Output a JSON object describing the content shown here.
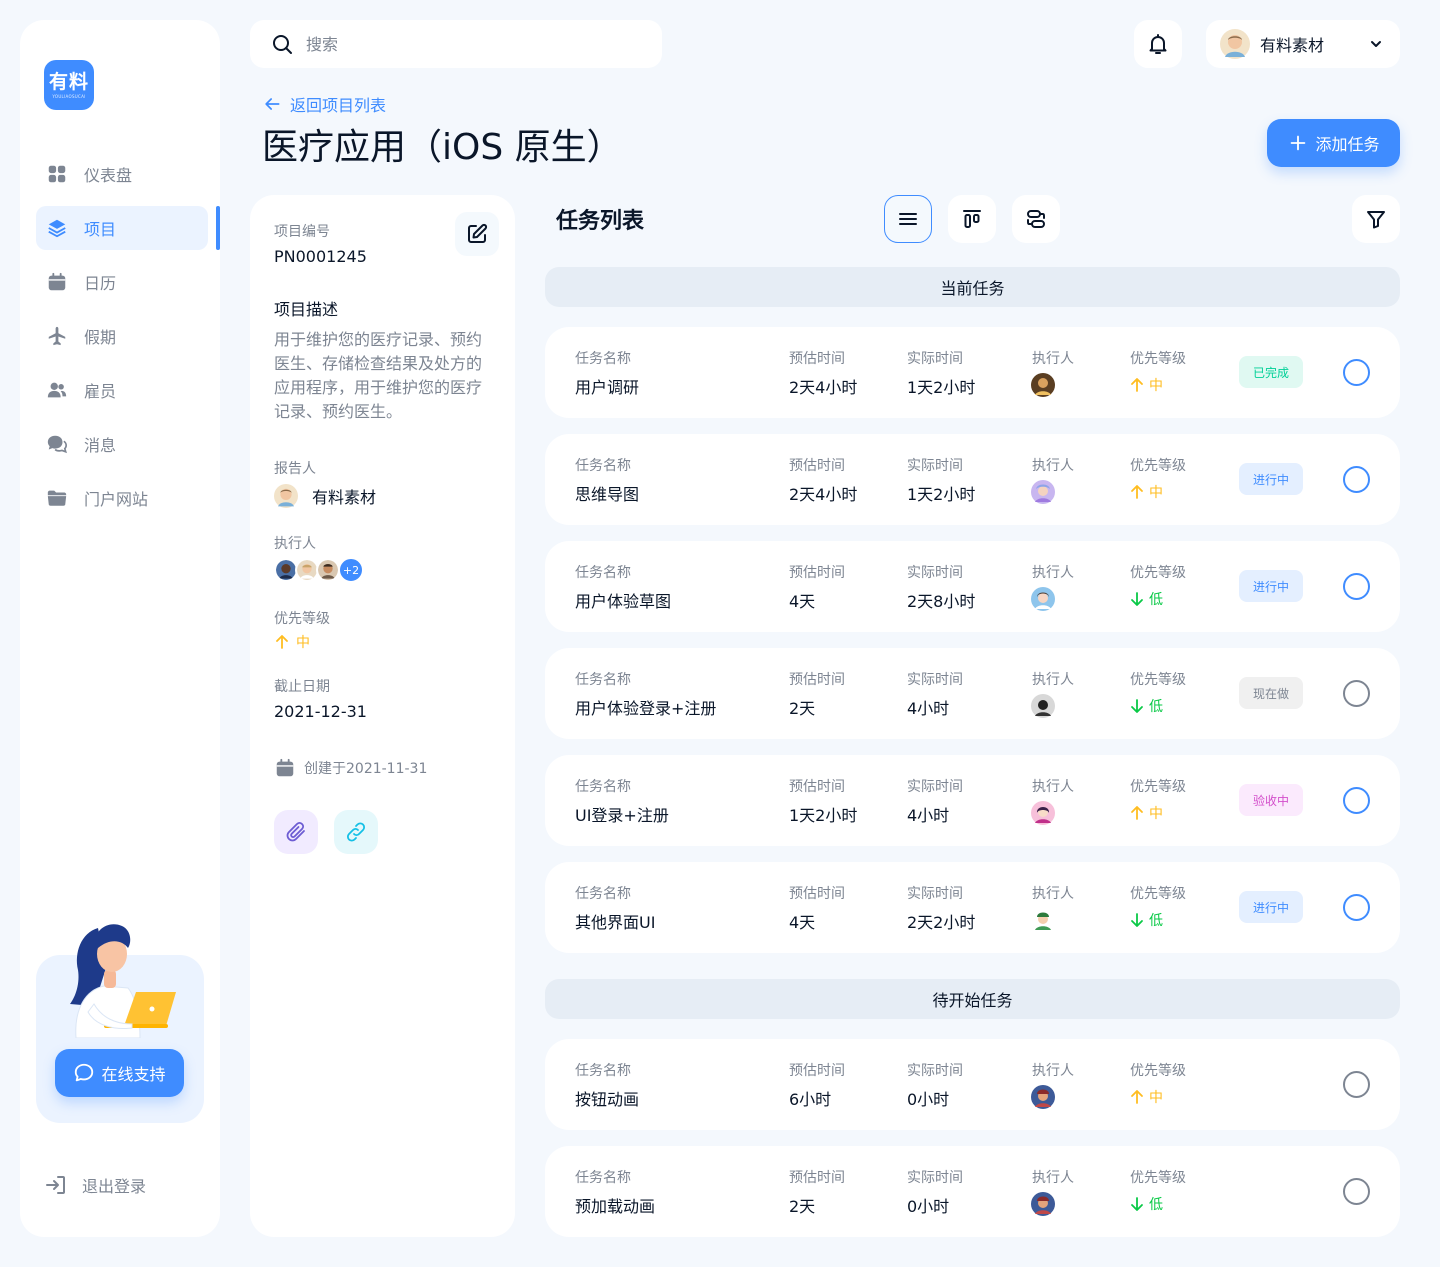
{
  "colors": {
    "primary": "#3f8cff",
    "medium": "#ffbd21",
    "low": "#0ac947",
    "done": "#00d097",
    "review": "#de92eb",
    "grey": "#7d8592"
  },
  "logo": {
    "text": "有料",
    "sub": "YOULIAOSUCAI"
  },
  "sidebar": {
    "items": [
      {
        "label": "仪表盘",
        "icon": "dashboard-icon"
      },
      {
        "label": "项目",
        "icon": "layers-icon",
        "active": true
      },
      {
        "label": "日历",
        "icon": "calendar-icon"
      },
      {
        "label": "假期",
        "icon": "plane-icon"
      },
      {
        "label": "雇员",
        "icon": "users-icon"
      },
      {
        "label": "消息",
        "icon": "chat-icon"
      },
      {
        "label": "门户网站",
        "icon": "folder-icon"
      }
    ],
    "support_label": "在线支持",
    "logout_label": "退出登录"
  },
  "search": {
    "placeholder": "搜索"
  },
  "user": {
    "name": "有料素材"
  },
  "header": {
    "back_label": "返回项目列表",
    "title": "医疗应用（iOS 原生）",
    "add_task_label": "添加任务"
  },
  "info": {
    "number_label": "项目编号",
    "number": "PN0001245",
    "desc_title": "项目描述",
    "description": "用于维护您的医疗记录、预约医生、存储检查结果及处方的应用程序，用于维护您的医疗记录、预约医生。",
    "reporter_label": "报告人",
    "reporter": "有料素材",
    "assignees_label": "执行人",
    "assignees_more": "+2",
    "priority_label": "优先等级",
    "priority": "中",
    "due_label": "截止日期",
    "due": "2021-12-31",
    "created": "创建于2021-11-31"
  },
  "tasks": {
    "title": "任务列表",
    "columns": {
      "name": "任务名称",
      "estimate": "预估时间",
      "actual": "实际时间",
      "assignee": "执行人",
      "priority": "优先等级"
    },
    "current_label": "当前任务",
    "upcoming_label": "待开始任务",
    "current": [
      {
        "name": "用户调研",
        "estimate": "2天4小时",
        "actual": "1天2小时",
        "priority": "中",
        "status": "已完成"
      },
      {
        "name": "思维导图",
        "estimate": "2天4小时",
        "actual": "1天2小时",
        "priority": "中",
        "status": "进行中"
      },
      {
        "name": "用户体验草图",
        "estimate": "4天",
        "actual": "2天8小时",
        "priority": "低",
        "status": "进行中"
      },
      {
        "name": "用户体验登录+注册",
        "estimate": "2天",
        "actual": "4小时",
        "priority": "低",
        "status": "现在做"
      },
      {
        "name": "UI登录+注册",
        "estimate": "1天2小时",
        "actual": "4小时",
        "priority": "中",
        "status": "验收中"
      },
      {
        "name": "其他界面UI",
        "estimate": "4天",
        "actual": "2天2小时",
        "priority": "低",
        "status": "进行中"
      }
    ],
    "upcoming": [
      {
        "name": "按钮动画",
        "estimate": "6小时",
        "actual": "0小时",
        "priority": "中"
      },
      {
        "name": "预加载动画",
        "estimate": "2天",
        "actual": "0小时",
        "priority": "低"
      }
    ]
  }
}
